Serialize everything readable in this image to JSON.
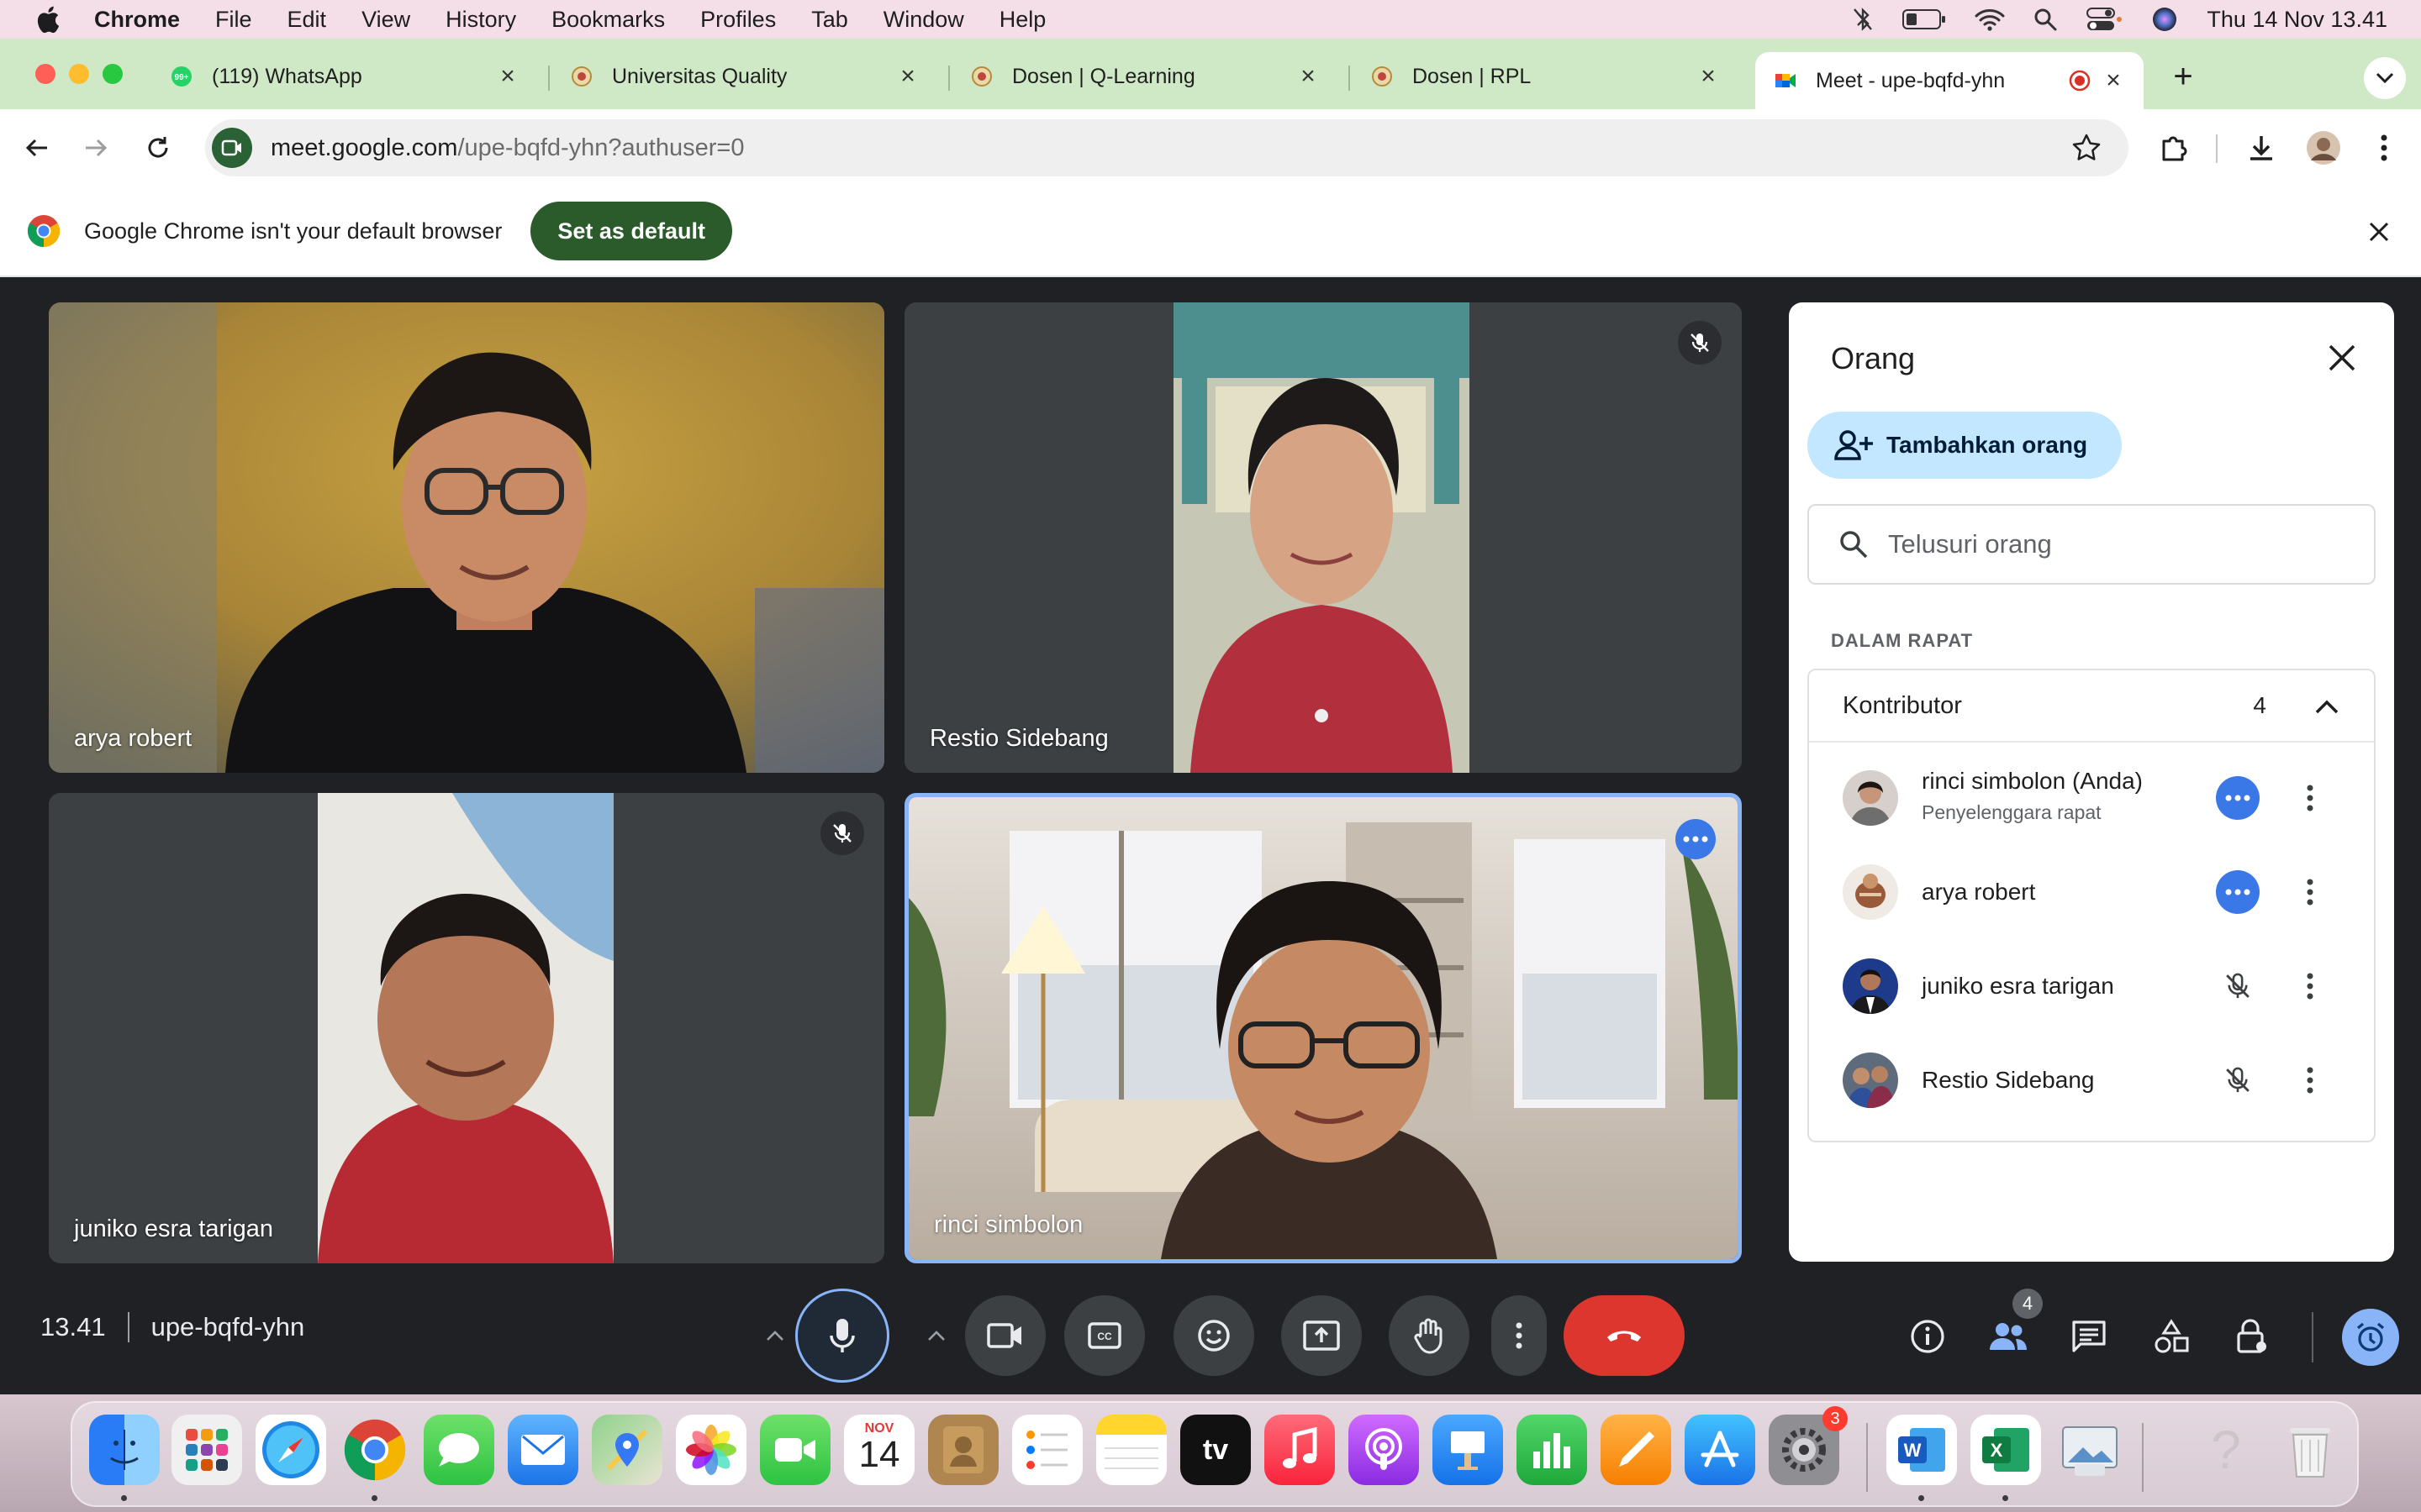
{
  "menubar": {
    "app_name": "Chrome",
    "menus": [
      "File",
      "Edit",
      "View",
      "History",
      "Bookmarks",
      "Profiles",
      "Tab",
      "Window",
      "Help"
    ],
    "clock": "Thu 14 Nov  13.41"
  },
  "tabs": [
    {
      "title": "(119) WhatsApp",
      "icon": "whatsapp-icon"
    },
    {
      "title": "Universitas Quality",
      "icon": "university-crest-icon"
    },
    {
      "title": "Dosen | Q-Learning",
      "icon": "university-crest-icon"
    },
    {
      "title": "Dosen | RPL",
      "icon": "university-crest-icon"
    },
    {
      "title": "Meet - upe-bqfd-yhn",
      "icon": "google-meet-icon",
      "active": true
    }
  ],
  "omnibox": {
    "host": "meet.google.com",
    "path": "/upe-bqfd-yhn?authuser=0"
  },
  "infobar": {
    "message": "Google Chrome isn't your default browser",
    "button": "Set as default"
  },
  "tiles": [
    {
      "name": "arya robert",
      "muted": false
    },
    {
      "name": "Restio Sidebang",
      "muted": true
    },
    {
      "name": "juniko esra tarigan",
      "muted": true
    },
    {
      "name": "rinci simbolon",
      "muted": false,
      "active_speaker": true
    }
  ],
  "panel": {
    "title": "Orang",
    "add_button": "Tambahkan orang",
    "search_placeholder": "Telusuri orang",
    "section_label": "DALAM RAPAT",
    "group_label": "Kontributor",
    "group_count": "4",
    "people": [
      {
        "name": "rinci simbolon (Anda)",
        "subtitle": "Penyelenggara rapat",
        "status": "more-options"
      },
      {
        "name": "arya robert",
        "subtitle": "",
        "status": "more-options"
      },
      {
        "name": "juniko esra tarigan",
        "subtitle": "",
        "status": "muted"
      },
      {
        "name": "Restio Sidebang",
        "subtitle": "",
        "status": "muted"
      }
    ]
  },
  "controls": {
    "time": "13.41",
    "meeting_code": "upe-bqfd-yhn",
    "people_badge": "4"
  },
  "dock": {
    "calendar_month": "NOV",
    "calendar_day": "14",
    "settings_badge": "3",
    "apple_tv_label": "tv",
    "apps": [
      "finder",
      "launchpad",
      "safari",
      "chrome",
      "messages",
      "mail",
      "maps",
      "photos",
      "facetime",
      "calendar",
      "contacts",
      "reminders",
      "notes",
      "apple-tv",
      "music",
      "podcasts",
      "keynote",
      "numbers",
      "pages",
      "app-store",
      "system-settings",
      "word",
      "excel",
      "preview",
      "help",
      "trash"
    ]
  },
  "colors": {
    "meet_bg": "#202124",
    "tab_strip": "#cfe9c7",
    "end_call": "#dc362e",
    "accent_blue": "#8ab4f8"
  }
}
